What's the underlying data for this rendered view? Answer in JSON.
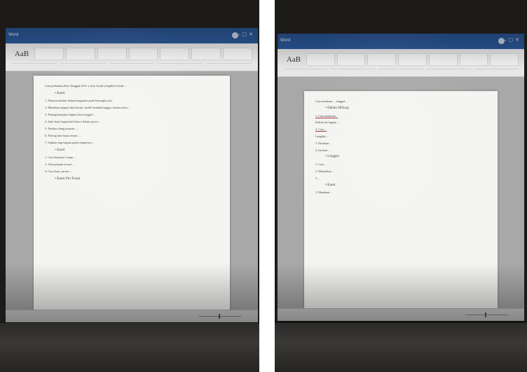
{
  "photos": [
    {
      "app_title": "Word",
      "user_label": "",
      "ribbon_big_label": "AaB",
      "document": {
        "intro": "Cara perbaikan Box Tanggal 2011 a. hilo Guide (ilegible) Guide ...",
        "headings": [
          "Karet",
          "Karet",
          "Karet Pm Tutuk"
        ],
        "paragraphs": [
          "1. Putaran tandasi dalam bangunan pada kerangka asli...",
          "2. Menahan tangkai dan berani, ambil bisukah/tunggu, ketemu bisa ...",
          "3. Pasang berputar bagian baut tanggal ...",
          "4. Jepit baut bagian beli kunci dalam posisi ...",
          "5. Periksa ulang putaran ...",
          "6. Potong dan lepas sesuai ...",
          "7. Sajikan tiap bagian pada tempatnya ...",
          "1. Cara berputar Garpu ...",
          "2. Alur putaran sesuai ...",
          "3. Cara baru, proses ..."
        ]
      }
    },
    {
      "app_title": "Word",
      "user_label": "",
      "ribbon_big_label": "AaB",
      "document": {
        "intro": "Cara membuat ... tanggal ...",
        "headings": [
          "Dalam Hidung",
          "Lingges",
          "Karet"
        ],
        "paragraphs": [
          "1. Cara membuat...",
          "Kulitan ke bagian ...",
          "2. Cara ...",
          "Langkah ...",
          "3. Pasarkan ...",
          "4. Ini kelir ...",
          "1. Cara ...",
          "2. Diletakkan ...",
          "3. ...",
          "1. Membuat ..."
        ]
      }
    }
  ]
}
